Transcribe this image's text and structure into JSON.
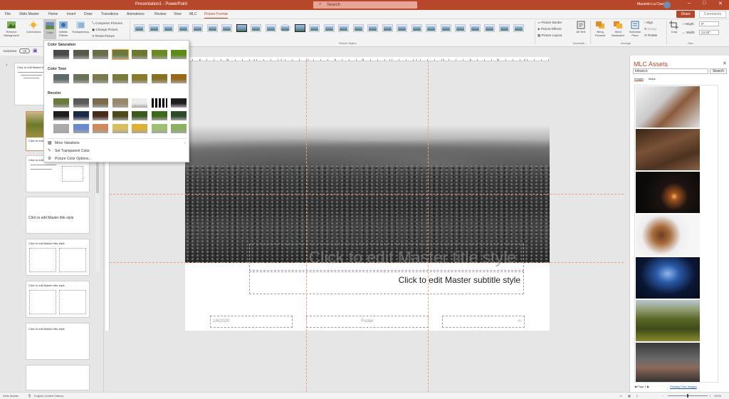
{
  "titlebar": {
    "title": "Presentation1  -  PowerPoint",
    "search_placeholder": "Search",
    "user": "Maurizio La Cava",
    "min": "–",
    "max": "□",
    "close": "✕"
  },
  "tabs": [
    {
      "label": "File"
    },
    {
      "label": "Slide Master"
    },
    {
      "label": "Home"
    },
    {
      "label": "Insert"
    },
    {
      "label": "Draw"
    },
    {
      "label": "Transitions"
    },
    {
      "label": "Animations"
    },
    {
      "label": "Review"
    },
    {
      "label": "View"
    },
    {
      "label": "MLC"
    },
    {
      "label": "Picture Format",
      "active": true
    }
  ],
  "share": "Share",
  "comments": "Comments",
  "ribbon": {
    "remove_bg": "Remove Background",
    "corrections": "Corrections",
    "color": "Color",
    "artistic": "Artistic Effects",
    "transparency": "Transparency",
    "compress": "Compress Pictures",
    "change": "Change Picture",
    "reset": "Reset Picture",
    "picture_border": "Picture Border",
    "picture_effects": "Picture Effects",
    "picture_layout": "Picture Layout",
    "alt_text": "Alt Text",
    "bring_forward": "Bring Forward",
    "send_backward": "Send Backward",
    "selection_pane": "Selection Pane",
    "align": "Align",
    "group": "Group",
    "rotate": "Rotate",
    "crop": "Crop",
    "height_label": "Height:",
    "height": "5\"",
    "width_label": "Width:",
    "width": "13.33\"",
    "groups": {
      "picture_styles": "Picture Styles",
      "accessibility": "Accessib...",
      "arrange": "Arrange",
      "size": "Size"
    }
  },
  "autosave": {
    "label": "AutoSave",
    "state": "Off"
  },
  "thumbs": [
    {
      "n": "1",
      "title": "Click to edit Master title style"
    },
    {
      "title": "Click to edit Master title style"
    },
    {
      "title": "Click to edit Master title style"
    },
    {
      "title": "Click to edit Master title style"
    },
    {
      "title": "Click to edit Master title style"
    },
    {
      "title": "Click to edit Master title style"
    },
    {
      "title": "Click to edit Master title style"
    }
  ],
  "ruler": [
    "6",
    "5",
    "4",
    "3",
    "2",
    "1",
    "0",
    "1",
    "2",
    "3",
    "4",
    "5",
    "6"
  ],
  "slide": {
    "title": "Click to edit Master title style",
    "subtitle": "Click to edit Master subtitle style",
    "date": "1/6/2020",
    "footer": "Footer",
    "number": "‹#›"
  },
  "pane": {
    "title": "MLC Assets",
    "query": "tobacco",
    "search": "Search",
    "tabs": [
      "Images",
      "Maps"
    ],
    "page": "Page 1",
    "pixabay": "Pixabay Free Images"
  },
  "colormenu": {
    "saturation": "Color Saturation",
    "tone": "Color Tone",
    "recolor": "Recolor",
    "more": "More Variations",
    "transparent": "Set Transparent Color",
    "options": "Picture Color Options..."
  },
  "status": {
    "mode": "Slide Master",
    "lang": "English (United States)",
    "zoom": "100%"
  },
  "colors": {
    "accent": "#b7472a",
    "guide": "#e4a08a"
  }
}
